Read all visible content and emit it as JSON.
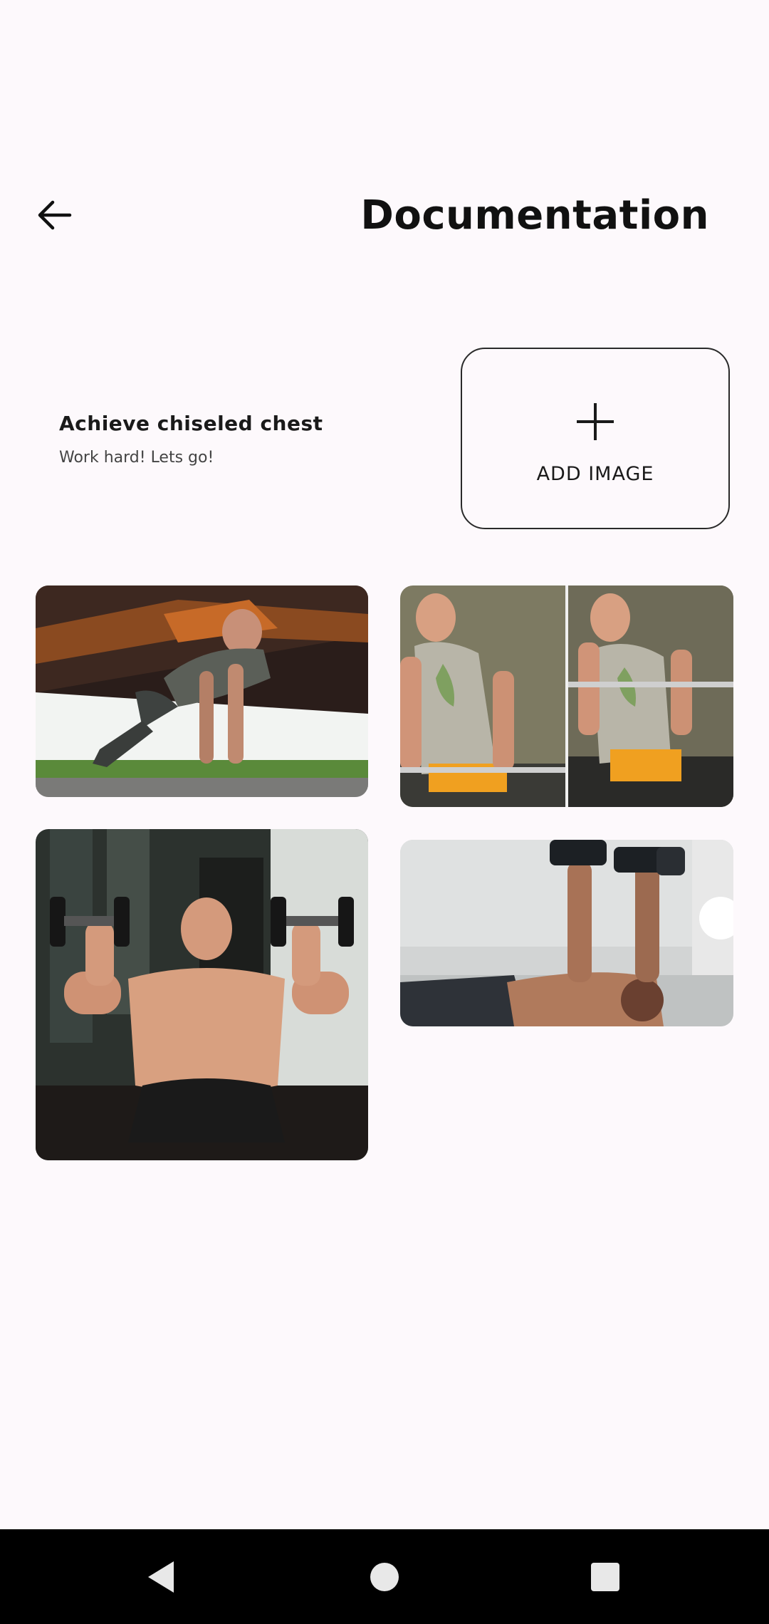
{
  "header": {
    "title": "Documentation",
    "back_icon": "arrow-left-icon"
  },
  "goal": {
    "title": "Achieve chiseled chest",
    "subtitle": "Work hard! Lets go!"
  },
  "add_image": {
    "icon": "plus-icon",
    "label": "ADD IMAGE"
  },
  "gallery": [
    {
      "name": "push-up-photo"
    },
    {
      "name": "dips-photo"
    },
    {
      "name": "incline-dumbbell-press-photo"
    },
    {
      "name": "dumbbell-bench-press-photo"
    }
  ],
  "nav": {
    "back_icon": "triangle-back-icon",
    "home_icon": "circle-home-icon",
    "recents_icon": "square-recents-icon"
  },
  "colors": {
    "background": "#fdf9fc",
    "text": "#111111",
    "nav_bar": "#000000"
  }
}
